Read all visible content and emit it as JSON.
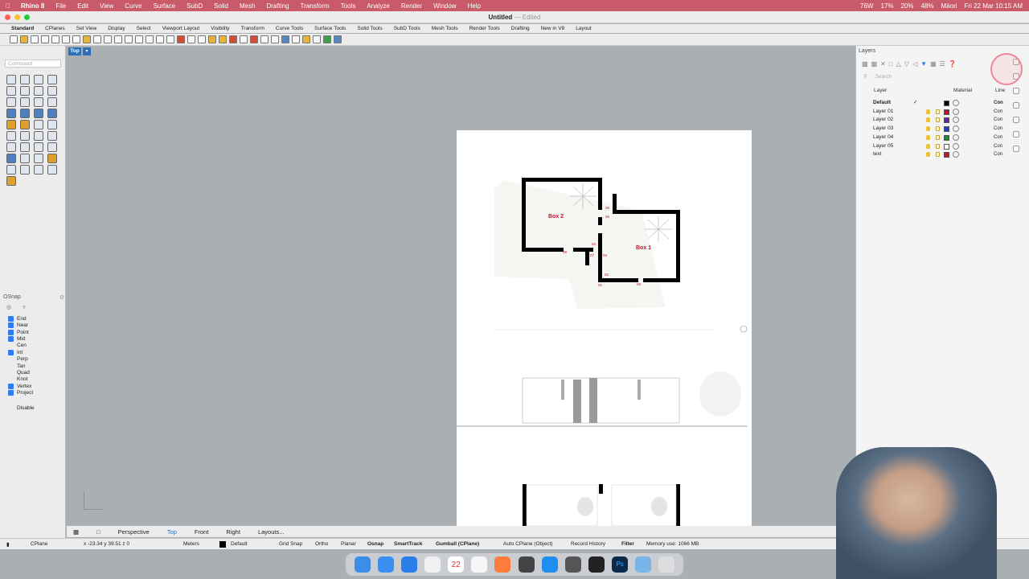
{
  "menubar": {
    "app": "Rhino 8",
    "items": [
      "File",
      "Edit",
      "View",
      "Curve",
      "Surface",
      "SubD",
      "Solid",
      "Mesh",
      "Drafting",
      "Transform",
      "Tools",
      "Analyze",
      "Render",
      "Window",
      "Help"
    ],
    "status": [
      "76W",
      "17%",
      "20%",
      "48%",
      "Māori",
      "Fri 22 Mar 10:15 AM"
    ]
  },
  "title": {
    "name": "Untitled",
    "suffix": "— Edited"
  },
  "tabs": [
    "Standard",
    "CPlanes",
    "Set View",
    "Display",
    "Select",
    "Viewport Layout",
    "Visibility",
    "Transform",
    "Curve Tools",
    "Surface Tools",
    "Solid Tools",
    "SubD Tools",
    "Mesh Tools",
    "Render Tools",
    "Drafting",
    "New in V8",
    "Layout"
  ],
  "command": {
    "placeholder": "Command"
  },
  "viewport": {
    "label": "Top",
    "annotations": {
      "box2": "Box 2",
      "box1": "Box 1",
      "tags": [
        "05",
        "06",
        "04",
        "07",
        "03",
        "02",
        "01",
        "08",
        "09"
      ]
    }
  },
  "osnap": {
    "title": "OSnap",
    "items": [
      {
        "label": "End",
        "on": true
      },
      {
        "label": "Near",
        "on": true
      },
      {
        "label": "Point",
        "on": true
      },
      {
        "label": "Mid",
        "on": true
      },
      {
        "label": "Cen",
        "on": false
      },
      {
        "label": "Int",
        "on": true
      },
      {
        "label": "Perp",
        "on": false
      },
      {
        "label": "Tan",
        "on": false
      },
      {
        "label": "Quad",
        "on": false
      },
      {
        "label": "Knot",
        "on": false
      },
      {
        "label": "Vertex",
        "on": true
      },
      {
        "label": "Project",
        "on": true
      }
    ],
    "disable": "Disable"
  },
  "layers": {
    "title": "Layers",
    "search_placeholder": "Search",
    "col_layer": "Layer",
    "col_material": "Material",
    "col_linetype": "Line",
    "rows": [
      {
        "name": "Default",
        "current": true,
        "color": "#000000",
        "lt": "Con"
      },
      {
        "name": "Layer 01",
        "current": false,
        "color": "#c8102e",
        "lt": "Con"
      },
      {
        "name": "Layer 02",
        "current": false,
        "color": "#6a1fb0",
        "lt": "Con"
      },
      {
        "name": "Layer 03",
        "current": false,
        "color": "#1f3fc8",
        "lt": "Con"
      },
      {
        "name": "Layer 04",
        "current": false,
        "color": "#1f8a2e",
        "lt": "Con"
      },
      {
        "name": "Layer 05",
        "current": false,
        "color": "#ffffff",
        "lt": "Con"
      },
      {
        "name": "text",
        "current": false,
        "color": "#c8102e",
        "lt": "Con"
      }
    ],
    "checkmark": "✓"
  },
  "viewtabs": [
    "Perspective",
    "Top",
    "Front",
    "Right",
    "Layouts..."
  ],
  "status": {
    "cplane": "CPlane",
    "coords": "x -23.34  y 39.51  z 0",
    "units": "Meters",
    "layer": "Default",
    "grid_snap": "Grid Snap",
    "ortho": "Ortho",
    "planar": "Planar",
    "osnap": "Osnap",
    "smarttrack": "SmartTrack",
    "gumball": "Gumball (CPlane)",
    "autocplane": "Auto CPlane (Object)",
    "record": "Record History",
    "filter": "Filter",
    "memory": "Memory use: 1066 MB"
  },
  "dock": {
    "date": "22"
  }
}
